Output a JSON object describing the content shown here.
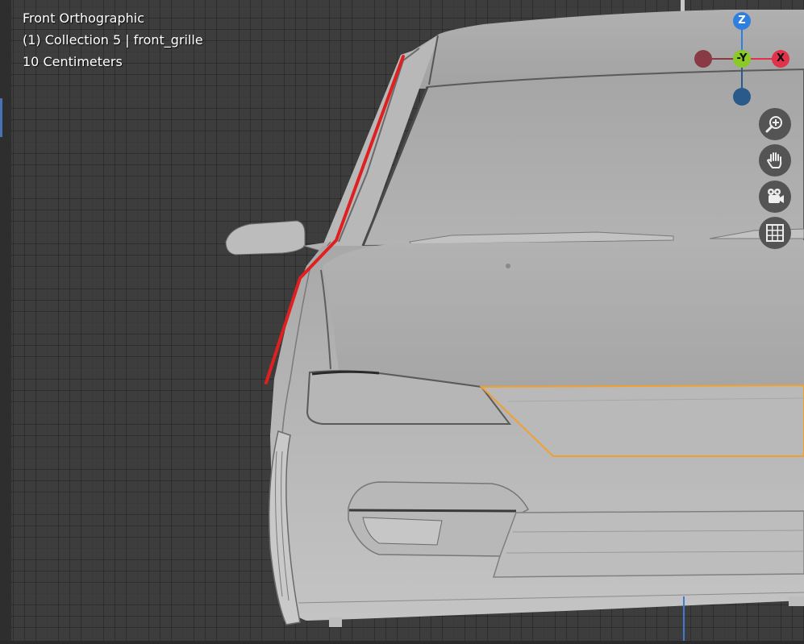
{
  "viewport": {
    "view_name": "Front Orthographic",
    "object_info": "(1) Collection 5 | front_grille",
    "scale_info": "10 Centimeters"
  },
  "gizmo": {
    "z_label": "Z",
    "y_label": "-Y",
    "x_label": "X",
    "colors": {
      "z": "#2f7fe0",
      "y": "#8ac926",
      "x": "#e0324a",
      "neg_x": "#8a3a45",
      "neg_z": "#2a5a8c"
    }
  },
  "navigation": [
    {
      "icon": "zoom-icon"
    },
    {
      "icon": "pan-hand-icon"
    },
    {
      "icon": "camera-icon"
    },
    {
      "icon": "grid-toggle-icon"
    }
  ],
  "colors": {
    "selection_outline": "#f0a030",
    "annotation_stroke": "#e02020",
    "model_body": "#b4b4b4"
  }
}
